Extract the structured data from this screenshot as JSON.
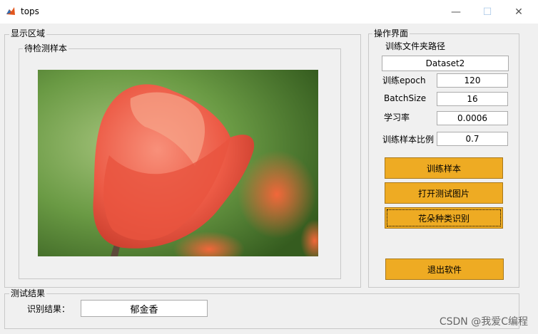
{
  "window": {
    "title": "tops",
    "minimize_glyph": "—",
    "maximize_glyph": "☐",
    "close_glyph": "✕"
  },
  "display_panel": {
    "label": "显示区域",
    "sample_group_label": "待检测样本"
  },
  "ops_panel": {
    "label": "操作界面",
    "folder_label": "训练文件夹路径",
    "folder_value": "Dataset2",
    "epoch_label": "训练epoch",
    "epoch_value": "120",
    "batch_label": "BatchSize",
    "batch_value": "16",
    "lr_label": "学习率",
    "lr_value": "0.0006",
    "ratio_label": "训练样本比例",
    "ratio_value": "0.7",
    "train_button": "训练样本",
    "open_button": "打开测试图片",
    "recognize_button": "花朵种类识别",
    "exit_button": "退出软件"
  },
  "result_panel": {
    "label": "测试结果",
    "result_label": "识别结果：",
    "result_value": "郁金香"
  },
  "watermark": "CSDN @我爱C编程",
  "colors": {
    "button_fill": "#eeab23",
    "panel_bg": "#f0f0f0",
    "border": "#c8c8c8"
  },
  "icons": {
    "app": "matlab-icon"
  }
}
